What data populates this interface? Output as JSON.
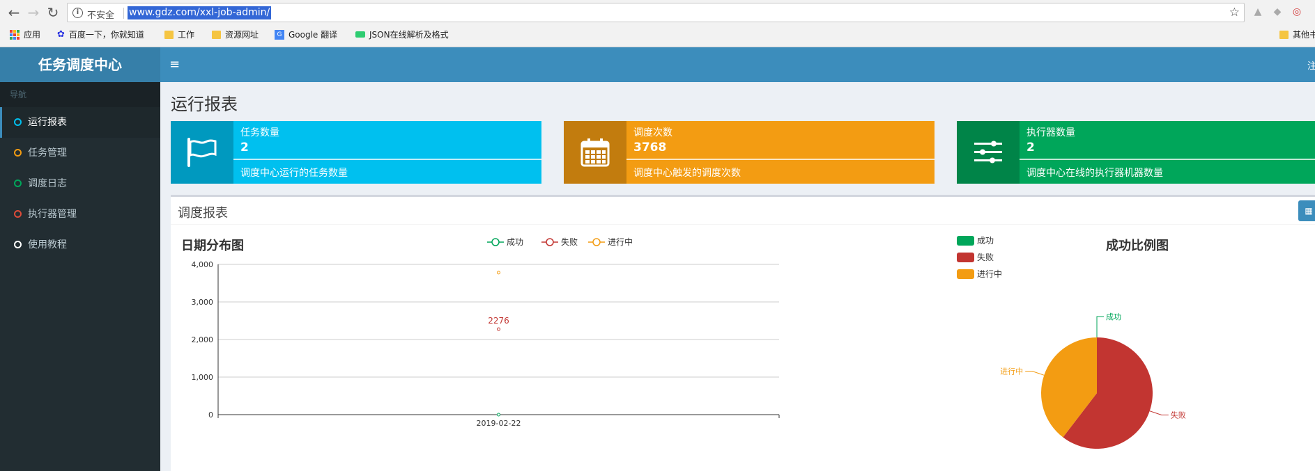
{
  "browser": {
    "insecure_label": "不安全",
    "url": "www.gdz.com/xxl-job-admin/",
    "bookmarks": [
      {
        "label": "应用"
      },
      {
        "label": "百度一下，你就知道"
      },
      {
        "label": "工作"
      },
      {
        "label": "资源网址"
      },
      {
        "label": "Google 翻译"
      },
      {
        "label": "JSON在线解析及格式"
      },
      {
        "label": "其他书"
      }
    ]
  },
  "header": {
    "logo": "任务调度中心",
    "toggle_icon": "≡",
    "right_text": "注"
  },
  "sidebar": {
    "header": "导航",
    "items": [
      {
        "label": "运行报表",
        "color": "#00c0ef",
        "active": true
      },
      {
        "label": "任务管理",
        "color": "#f39c12",
        "active": false
      },
      {
        "label": "调度日志",
        "color": "#00a65a",
        "active": false
      },
      {
        "label": "执行器管理",
        "color": "#dd4b39",
        "active": false
      },
      {
        "label": "使用教程",
        "color": "#ffffff",
        "active": false
      }
    ]
  },
  "page": {
    "title": "运行报表"
  },
  "info_boxes": [
    {
      "label": "任务数量",
      "number": "2",
      "desc": "调度中心运行的任务数量",
      "icon": "flag-icon",
      "color": "#00c0ef"
    },
    {
      "label": "调度次数",
      "number": "3768",
      "desc": "调度中心触发的调度次数",
      "icon": "calendar-icon",
      "color": "#f39c12"
    },
    {
      "label": "执行器数量",
      "number": "2",
      "desc": "调度中心在线的执行器机器数量",
      "icon": "sliders-icon",
      "color": "#00a65a"
    }
  ],
  "report": {
    "title": "调度报表",
    "date_button_icon": "calendar-icon"
  },
  "chart_data": [
    {
      "type": "line",
      "title": "日期分布图",
      "x": [
        "2019-02-22"
      ],
      "series": [
        {
          "name": "成功",
          "values": [
            0
          ],
          "color": "#00a65a"
        },
        {
          "name": "失败",
          "values": [
            2276
          ],
          "color": "#c23531"
        },
        {
          "name": "进行中",
          "values": [
            3780
          ],
          "color": "#f39c12"
        }
      ],
      "data_labels": [
        "2276"
      ],
      "ylim": [
        0,
        4000
      ],
      "yticks": [
        "0",
        "1,000",
        "2,000",
        "3,000",
        "4,000"
      ],
      "grid": true,
      "legend": "top-center"
    },
    {
      "type": "pie",
      "title": "成功比例图",
      "slices": [
        {
          "name": "成功",
          "value": 0,
          "color": "#00a65a"
        },
        {
          "name": "失败",
          "value": 2276,
          "color": "#c23531"
        },
        {
          "name": "进行中",
          "value": 1492,
          "color": "#f39c12"
        }
      ],
      "legend": "top-left"
    }
  ]
}
